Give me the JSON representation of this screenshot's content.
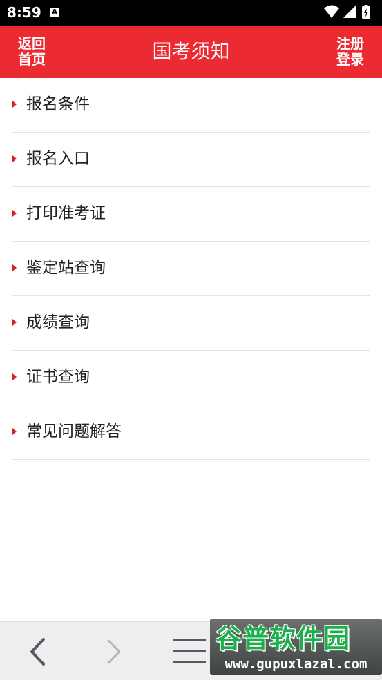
{
  "status_bar": {
    "time": "8:59",
    "notification_icon": "A"
  },
  "header": {
    "back_home_line1": "返回",
    "back_home_line2": "首页",
    "title": "国考须知",
    "register_line1": "注册",
    "register_line2": "登录"
  },
  "menu": [
    {
      "label": "报名条件"
    },
    {
      "label": "报名入口"
    },
    {
      "label": "打印准考证"
    },
    {
      "label": "鉴定站查询"
    },
    {
      "label": "成绩查询"
    },
    {
      "label": "证书查询"
    },
    {
      "label": "常见问题解答"
    }
  ],
  "watermark": {
    "logo": "谷普软件园",
    "url": "www.gupuxlazal.com"
  },
  "colors": {
    "header_red": "#ec2a32",
    "arrow_red": "#d9232b",
    "watermark_green": "#19b24a"
  },
  "icons": {
    "back": "chevron-left-icon",
    "forward": "chevron-right-icon",
    "menu": "hamburger-menu-icon"
  }
}
